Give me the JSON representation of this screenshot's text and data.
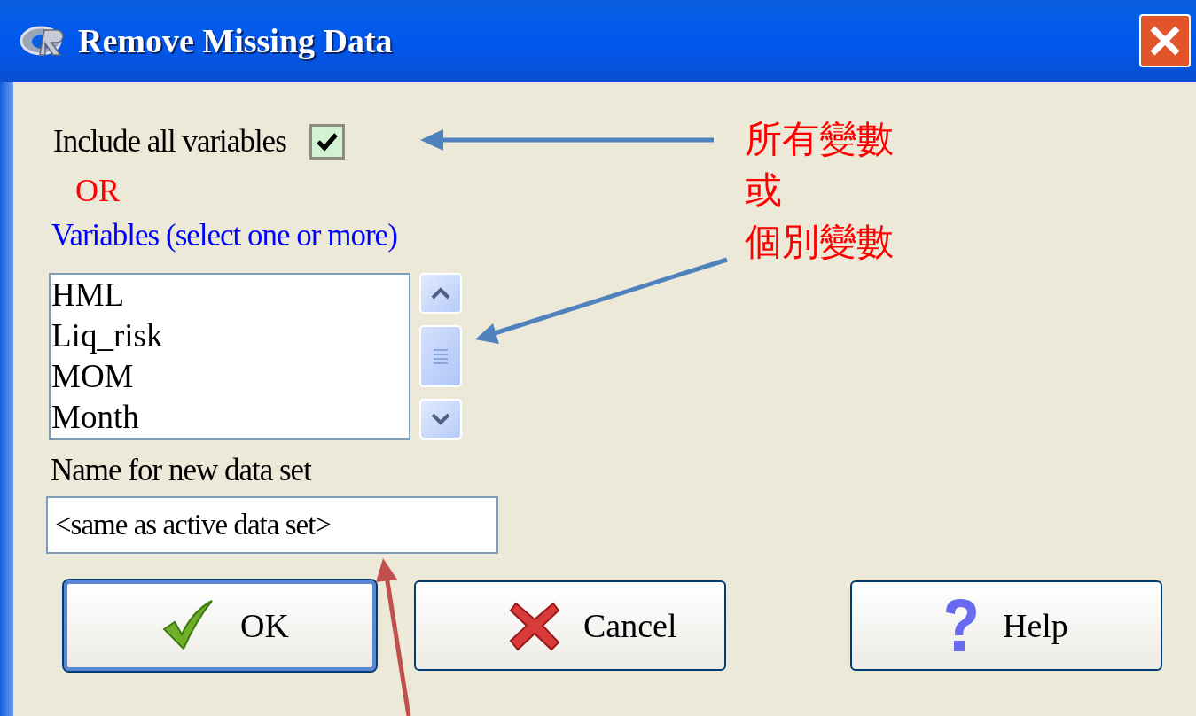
{
  "window": {
    "title": "Remove Missing Data"
  },
  "include_all": {
    "label": "Include all variables",
    "checked": true
  },
  "or_label": "OR",
  "variables": {
    "label": "Variables (select one or more)",
    "items": [
      "HML",
      "Liq_risk",
      "MOM",
      "Month"
    ]
  },
  "new_data_set": {
    "label": "Name for new data set",
    "value": "<same as active data set>"
  },
  "buttons": [
    {
      "kind": "ok",
      "label": "OK",
      "focused": true
    },
    {
      "kind": "cancel",
      "label": "Cancel",
      "focused": false
    },
    {
      "kind": "help",
      "label": "Help",
      "focused": false
    }
  ],
  "annotation_lines": [
    "所有變數",
    "或",
    "個別變數"
  ]
}
